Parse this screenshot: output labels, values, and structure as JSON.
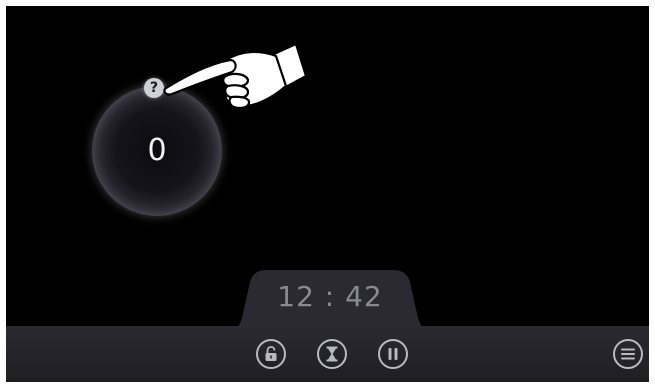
{
  "counter": {
    "value": "0",
    "help_glyph": "?"
  },
  "timer": {
    "time": "12 : 42"
  },
  "toolbar": {
    "buttons": [
      {
        "icon": "lock-icon"
      },
      {
        "icon": "hourglass-icon"
      },
      {
        "icon": "pause-icon"
      },
      {
        "icon": "menu-icon"
      }
    ]
  },
  "colors": {
    "background": "#000000",
    "bar": "#25252a",
    "icon": "#b9b9c0",
    "timer_text": "#8a8a92"
  }
}
